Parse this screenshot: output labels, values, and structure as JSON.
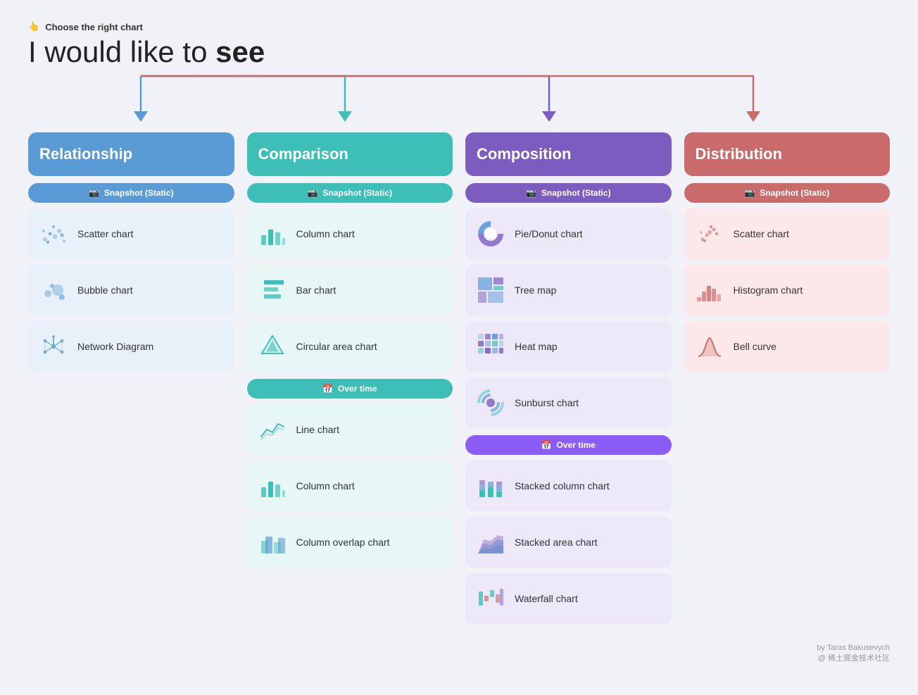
{
  "header": {
    "tip_icon": "👆",
    "tip_text": "Choose the right chart",
    "title_prefix": "I would like to ",
    "title_bold": "see"
  },
  "categories": [
    {
      "id": "relationship",
      "label": "Relationship",
      "color": "#5b9bd5",
      "bg_class": "cat-relationship",
      "sub_class": "sub-relationship",
      "col_class": "col-relationship",
      "sections": [
        {
          "label": "Snapshot (Static)",
          "icon": "📷",
          "items": [
            {
              "name": "Scatter chart",
              "icon_type": "scatter"
            },
            {
              "name": "Bubble chart",
              "icon_type": "bubble"
            },
            {
              "name": "Network Diagram",
              "icon_type": "network"
            }
          ]
        }
      ]
    },
    {
      "id": "comparison",
      "label": "Comparison",
      "color": "#3dbfb8",
      "bg_class": "cat-comparison",
      "sub_class": "sub-comparison",
      "col_class": "col-comparison",
      "sections": [
        {
          "label": "Snapshot (Static)",
          "icon": "📷",
          "items": [
            {
              "name": "Column chart",
              "icon_type": "column"
            },
            {
              "name": "Bar chart",
              "icon_type": "bar"
            },
            {
              "name": "Circular area chart",
              "icon_type": "circular"
            }
          ]
        },
        {
          "label": "Over time",
          "icon": "📅",
          "sub_class_override": "sub-overtime-comparison",
          "items": [
            {
              "name": "Line chart",
              "icon_type": "line"
            },
            {
              "name": "Column chart",
              "icon_type": "column"
            },
            {
              "name": "Column overlap chart",
              "icon_type": "column-overlap"
            }
          ]
        }
      ]
    },
    {
      "id": "composition",
      "label": "Composition",
      "color": "#7c5cbf",
      "bg_class": "cat-composition",
      "sub_class": "sub-composition",
      "col_class": "col-composition",
      "sections": [
        {
          "label": "Snapshot (Static)",
          "icon": "📷",
          "items": [
            {
              "name": "Pie/Donut chart",
              "icon_type": "donut"
            },
            {
              "name": "Tree map",
              "icon_type": "treemap"
            },
            {
              "name": "Heat map",
              "icon_type": "heatmap"
            },
            {
              "name": "Sunburst chart",
              "icon_type": "sunburst"
            }
          ]
        },
        {
          "label": "Over time",
          "icon": "📅",
          "sub_class_override": "sub-overtime-composition",
          "items": [
            {
              "name": "Stacked column chart",
              "icon_type": "stacked-column"
            },
            {
              "name": "Stacked area chart",
              "icon_type": "stacked-area"
            },
            {
              "name": "Waterfall chart",
              "icon_type": "waterfall"
            }
          ]
        }
      ]
    },
    {
      "id": "distribution",
      "label": "Distribution",
      "color": "#c96b6b",
      "bg_class": "cat-distribution",
      "sub_class": "sub-distribution",
      "col_class": "col-distribution",
      "sections": [
        {
          "label": "Snapshot (Static)",
          "icon": "📷",
          "items": [
            {
              "name": "Scatter chart",
              "icon_type": "scatter-dist"
            },
            {
              "name": "Histogram chart",
              "icon_type": "histogram"
            },
            {
              "name": "Bell curve",
              "icon_type": "bell"
            }
          ]
        }
      ]
    }
  ],
  "footer": {
    "line1": "by Taras Bakusevych",
    "line2": "@ 稀土掘金技术社区"
  }
}
